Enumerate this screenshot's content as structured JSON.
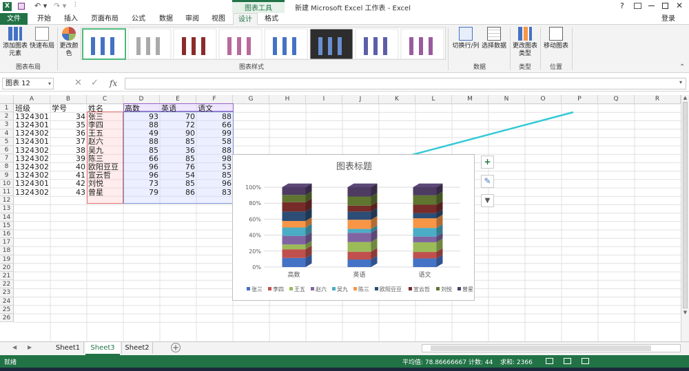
{
  "window": {
    "title": "新建 Microsoft Excel 工作表 - Excel",
    "chart_tools": "图表工具",
    "help": "?",
    "login": "登录"
  },
  "tabs": [
    {
      "label": "文件"
    },
    {
      "label": "开始"
    },
    {
      "label": "插入"
    },
    {
      "label": "页面布局"
    },
    {
      "label": "公式"
    },
    {
      "label": "数据"
    },
    {
      "label": "审阅"
    },
    {
      "label": "视图"
    },
    {
      "label": "设计"
    },
    {
      "label": "格式"
    }
  ],
  "ribbon": {
    "add_chart_element": "添加图表元素",
    "quick_layout": "快速布局",
    "change_colors": "更改颜色",
    "group_layout": "图表布局",
    "group_styles": "图表样式",
    "switch_row_col": "切换行/列",
    "select_data": "选择数据",
    "group_data": "数据",
    "change_type": "更改图表类型",
    "group_type": "类型",
    "move_chart": "移动图表",
    "group_location": "位置"
  },
  "formula_bar": {
    "name_box": "图表 12",
    "fx": "fx"
  },
  "columns": [
    "A",
    "B",
    "C",
    "D",
    "E",
    "F",
    "G",
    "H",
    "I",
    "J",
    "K",
    "L",
    "M",
    "N",
    "O",
    "P",
    "Q",
    "R"
  ],
  "rows": [
    "1",
    "2",
    "3",
    "4",
    "5",
    "6",
    "7",
    "8",
    "9",
    "10",
    "11",
    "12",
    "13",
    "14",
    "15",
    "16",
    "17",
    "18",
    "19",
    "20",
    "21",
    "22",
    "23",
    "24",
    "25",
    "26"
  ],
  "table": {
    "headers": [
      "班级",
      "学号",
      "姓名",
      "高数",
      "英语",
      "语文"
    ],
    "rows": [
      [
        "1324301",
        "34",
        "张三",
        "93",
        "70",
        "88"
      ],
      [
        "1324301",
        "35",
        "李四",
        "88",
        "72",
        "66"
      ],
      [
        "1324302",
        "36",
        "王五",
        "49",
        "90",
        "99"
      ],
      [
        "1324301",
        "37",
        "赵六",
        "88",
        "85",
        "58"
      ],
      [
        "1324302",
        "38",
        "吴九",
        "85",
        "36",
        "88"
      ],
      [
        "1324302",
        "39",
        "陈三",
        "66",
        "85",
        "98"
      ],
      [
        "1324302",
        "40",
        "欧阳豆豆",
        "96",
        "76",
        "53"
      ],
      [
        "1324302",
        "41",
        "宣云哲",
        "96",
        "54",
        "85"
      ],
      [
        "1324301",
        "42",
        "刘悦",
        "73",
        "85",
        "96"
      ],
      [
        "1324302",
        "43",
        "曾星",
        "79",
        "86",
        "83"
      ]
    ]
  },
  "chart_data": {
    "type": "bar",
    "subtype": "3d-100%-stacked-column",
    "title": "图表标题",
    "categories": [
      "高数",
      "英语",
      "语文"
    ],
    "ytick_labels": [
      "0%",
      "20%",
      "40%",
      "60%",
      "80%",
      "100%"
    ],
    "ylim": [
      0,
      1
    ],
    "legend_position": "bottom",
    "series": [
      {
        "name": "张三",
        "values": [
          93,
          70,
          88
        ],
        "color": "#4472c4"
      },
      {
        "name": "李四",
        "values": [
          88,
          72,
          66
        ],
        "color": "#c0504d"
      },
      {
        "name": "王五",
        "values": [
          49,
          90,
          99
        ],
        "color": "#9bbb59"
      },
      {
        "name": "赵六",
        "values": [
          88,
          85,
          58
        ],
        "color": "#8064a2"
      },
      {
        "name": "吴九",
        "values": [
          85,
          36,
          88
        ],
        "color": "#4bacc6"
      },
      {
        "name": "陈三",
        "values": [
          66,
          85,
          98
        ],
        "color": "#f79646"
      },
      {
        "name": "欧阳豆豆",
        "values": [
          96,
          76,
          53
        ],
        "color": "#2c4d75"
      },
      {
        "name": "宣云哲",
        "values": [
          96,
          54,
          85
        ],
        "color": "#772c2a"
      },
      {
        "name": "刘悦",
        "values": [
          73,
          85,
          96
        ],
        "color": "#5f7530"
      },
      {
        "name": "曾星",
        "values": [
          79,
          86,
          83
        ],
        "color": "#4d3b62"
      }
    ]
  },
  "sheets": [
    {
      "label": "Sheet1"
    },
    {
      "label": "Sheet3"
    },
    {
      "label": "Sheet2"
    }
  ],
  "status": {
    "ready": "就绪",
    "average": "平均值: 78.86666667",
    "count": "计数: 44",
    "sum": "求和: 2366"
  },
  "colors": {
    "excel_green": "#217346",
    "accent_cyan": "#33c9d6"
  }
}
